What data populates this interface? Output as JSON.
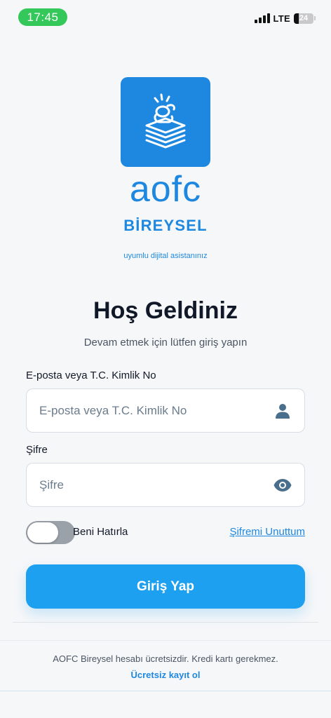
{
  "status_bar": {
    "time": "17:45",
    "network": "LTE",
    "battery": "24",
    "battery_level_percent": 24,
    "time_pill_color": "#34c759"
  },
  "brand": {
    "name": "aofc",
    "subtitle": "BİREYSEL",
    "tagline": "uyumlu dijital asistanınız",
    "color": "#1e88e0",
    "logo_icon": "stacked-documents-hand-icon"
  },
  "welcome": {
    "title": "Hoş Geldiniz",
    "subtitle": "Devam etmek için lütfen giriş yapın"
  },
  "form": {
    "email_label": "E-posta veya T.C. Kimlik No",
    "email_placeholder": "E-posta veya T.C. Kimlik No",
    "email_value": "",
    "email_icon": "user-icon",
    "password_label": "Şifre",
    "password_placeholder": "Şifre",
    "password_value": "",
    "password_icon": "eye-icon",
    "remember_label": "Beni Hatırla",
    "remember_on": false,
    "forgot_link": "Şifremi Unuttum",
    "submit_label": "Giriş Yap",
    "accent_color": "#1ea0f0"
  },
  "footer": {
    "note": "AOFC Bireysel hesabı ücretsizdir. Kredi kartı gerekmez.",
    "signup_link": "Ücretsiz kayıt ol"
  }
}
